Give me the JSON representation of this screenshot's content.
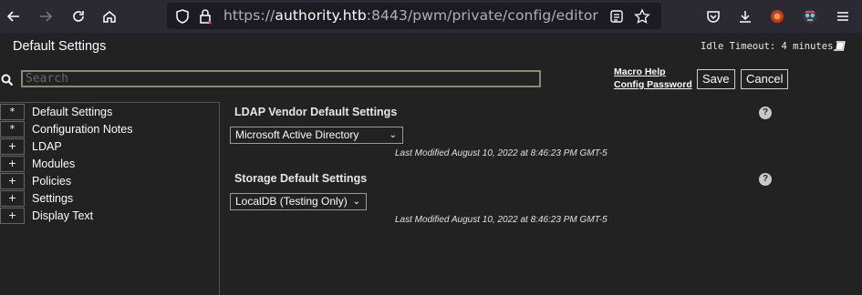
{
  "browser": {
    "url_host": "authority.htb",
    "url_port": ":8443",
    "url_path": "/pwm/private/config/editor",
    "url_scheme": "https://",
    "icons": [
      "back-icon",
      "forward-icon",
      "reload-icon",
      "home-icon",
      "shield-icon",
      "lock-icon",
      "reader-icon",
      "bookmark-star-icon",
      "pocket-icon",
      "download-icon",
      "extension-icon",
      "account-icon",
      "menu-icon"
    ]
  },
  "header": {
    "title": "Default Settings",
    "idle_timeout": "Idle Timeout: 4 minutes"
  },
  "search": {
    "placeholder": "Search",
    "value": ""
  },
  "links": {
    "macro_help": "Macro Help",
    "config_password": "Config Password"
  },
  "buttons": {
    "save": "Save",
    "cancel": "Cancel"
  },
  "nav": {
    "items": [
      {
        "toggle": "*",
        "label": "Default Settings"
      },
      {
        "toggle": "*",
        "label": "Configuration Notes"
      },
      {
        "toggle": "+",
        "label": "LDAP"
      },
      {
        "toggle": "+",
        "label": "Modules"
      },
      {
        "toggle": "+",
        "label": "Policies"
      },
      {
        "toggle": "+",
        "label": "Settings"
      },
      {
        "toggle": "+",
        "label": "Display Text"
      }
    ]
  },
  "settings": [
    {
      "title": "LDAP Vendor Default Settings",
      "selected": "Microsoft Active Directory",
      "modified": "Last Modified August 10, 2022 at 8:46:23 PM GMT-5",
      "help": "?"
    },
    {
      "title": "Storage Default Settings",
      "selected": "LocalDB (Testing Only)",
      "modified": "Last Modified August 10, 2022 at 8:46:23 PM GMT-5",
      "help": "?"
    }
  ]
}
